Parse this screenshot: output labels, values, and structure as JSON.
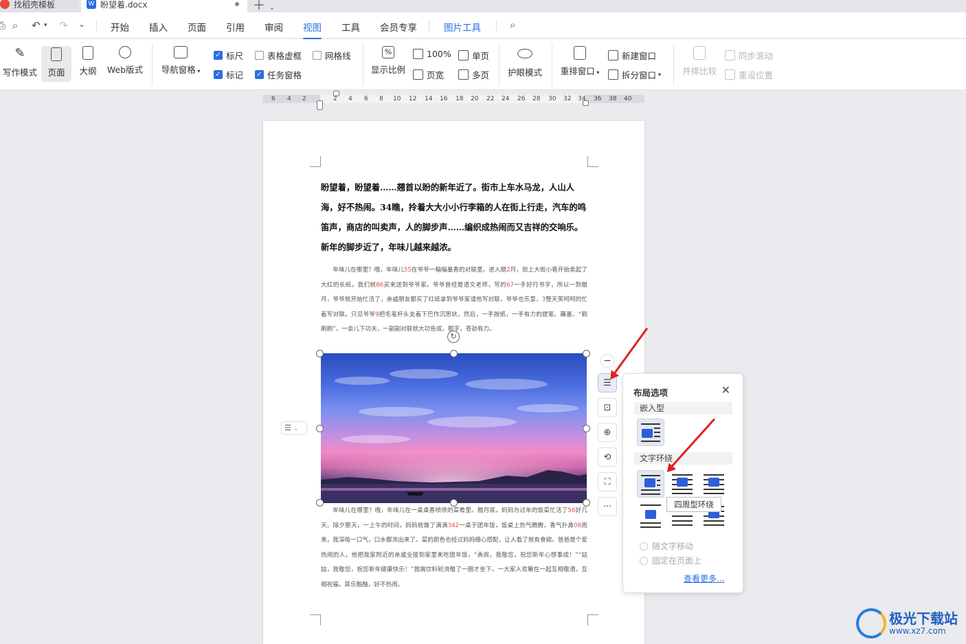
{
  "tabs": [
    {
      "label": "找稻壳模板"
    },
    {
      "label": "盼望着.docx"
    }
  ],
  "menu": {
    "items": [
      "开始",
      "插入",
      "页面",
      "引用",
      "审阅",
      "视图",
      "工具",
      "会员专享",
      "图片工具"
    ],
    "active": "视图"
  },
  "ribbon": {
    "writing_mode": "写作模式",
    "page": "页面",
    "outline": "大纲",
    "web_layout": "Web版式",
    "nav_pane": "导航窗格",
    "ruler": "标尺",
    "table_gridlines": "表格虚框",
    "gridlines": "网格线",
    "marks": "标记",
    "task_pane": "任务窗格",
    "zoom": "显示比例",
    "zoom_100": "100%",
    "page_width": "页宽",
    "single_page": "单页",
    "multi_page": "多页",
    "eye_care": "护眼模式",
    "rearrange": "重排窗口",
    "new_window": "新建窗口",
    "split_window": "拆分窗口",
    "side_by_side": "并排比较",
    "sync_scroll": "同步滚动",
    "reset_pos": "重设位置"
  },
  "ruler_ticks": [
    "6",
    "4",
    "2",
    "2",
    "4",
    "6",
    "8",
    "10",
    "12",
    "14",
    "16",
    "18",
    "20",
    "22",
    "24",
    "26",
    "28",
    "30",
    "32",
    "34",
    "36",
    "38",
    "40"
  ],
  "document": {
    "heading": "盼望着，盼望着……翘首以盼的新年近了。街市上车水马龙，人山人海，好不热闹。34瞧，拎着大大小小行李箱的人在街上行走，汽车的鸣笛声，商店的叫卖声，人的脚步声……编织成热闹而又吉祥的交响乐。新年的脚步近了，年味儿越来越浓。",
    "para1": [
      {
        "t": "年味儿在哪里？哦，年味儿"
      },
      {
        "t": "55",
        "red": true
      },
      {
        "t": "在爷爷一幅幅墨香的对联里。进入腊"
      },
      {
        "t": "2",
        "red": true
      },
      {
        "t": "月，街上大街小巷开始卖起了大红的长纸，我们就"
      },
      {
        "t": "86",
        "red": true
      },
      {
        "t": "买来送到爷爷家。爷爷曾经是语文老师，写的"
      },
      {
        "t": "67",
        "red": true
      },
      {
        "t": "一手好行书字，所以一到腊月，爷爷就开始忙活了，亲戚朋友都买了红纸拿到爷爷家请他写对联，爷爷也乐意，"
      },
      {
        "t": "3",
        "red": true
      },
      {
        "t": "整天笑呵呵的忙着写对联。只见爷爷"
      },
      {
        "t": "9",
        "red": true
      },
      {
        "t": "把毛笔杆头支着下巴作沉思状，然后，一手按纸，一手有力的提笔、蘸墨、“刷刷刷”，一会儿下功夫，一副副对联就大功告成，那字，苍劲有力。"
      }
    ],
    "para2": [
      {
        "t": "年味儿在哪里？哦，年味儿在一桌桌香喷喷的菜肴里。腊月底，妈妈为过年的饭菜忙活了"
      },
      {
        "t": "56",
        "red": true
      },
      {
        "t": "好几天。除夕那天，一上午的时间，妈妈就做了满满"
      },
      {
        "t": "342",
        "red": true
      },
      {
        "t": "一桌子团年饭，饭桌上热气腾腾，香气扑鼻"
      },
      {
        "t": "08",
        "red": true
      },
      {
        "t": "而来，我深吸一口气，口水都流出来了。菜的颜色也经过妈妈细心搭配，让人看了就有食欲。爸爸是个爱热闹的人，他把我家附近的亲戚全接到家里来吃团年饭，“表叔，我敬您，祝您新年心想事成！”“姑姑，我敬您，祝您新年健康快乐！”我端饮料轮流敬了一圈才坐下。一大家人欢聚在一起互相敬酒，互相祝福，其乐融融，好不热闹。"
      }
    ]
  },
  "layout_panel": {
    "title": "布局选项",
    "inline_section": "嵌入型",
    "wrap_section": "文字环绕",
    "tooltip": "四周型环绕",
    "move_with_text": "随文字移动",
    "fix_on_page": "固定在页面上",
    "see_more": "查看更多..."
  },
  "watermark": {
    "title": "极光下载站",
    "url": "www.xz7.com"
  },
  "colors": {
    "accent": "#2b6de5",
    "red_arrow": "#e02020",
    "red_numbers": "#e24a4a"
  }
}
